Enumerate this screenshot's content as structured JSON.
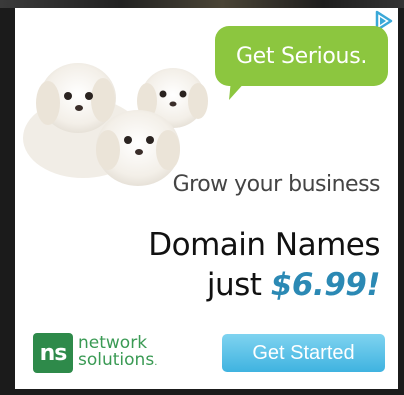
{
  "ad": {
    "speech_bubble": "Get Serious.",
    "tagline": "Grow your business",
    "headline_line1": "Domain Names",
    "headline_line2_prefix": "just ",
    "headline_price": "$6.99!",
    "logo_mark": "ns",
    "logo_line1": "network",
    "logo_line2": "solutions",
    "logo_trademark": ".",
    "cta_label": "Get Started",
    "adchoices_icon": "adchoices-icon"
  },
  "colors": {
    "bubble_green": "#8cc63f",
    "price_blue": "#2b89b4",
    "logo_green": "#2e8a4a",
    "cta_blue": "#3fb3e0"
  }
}
